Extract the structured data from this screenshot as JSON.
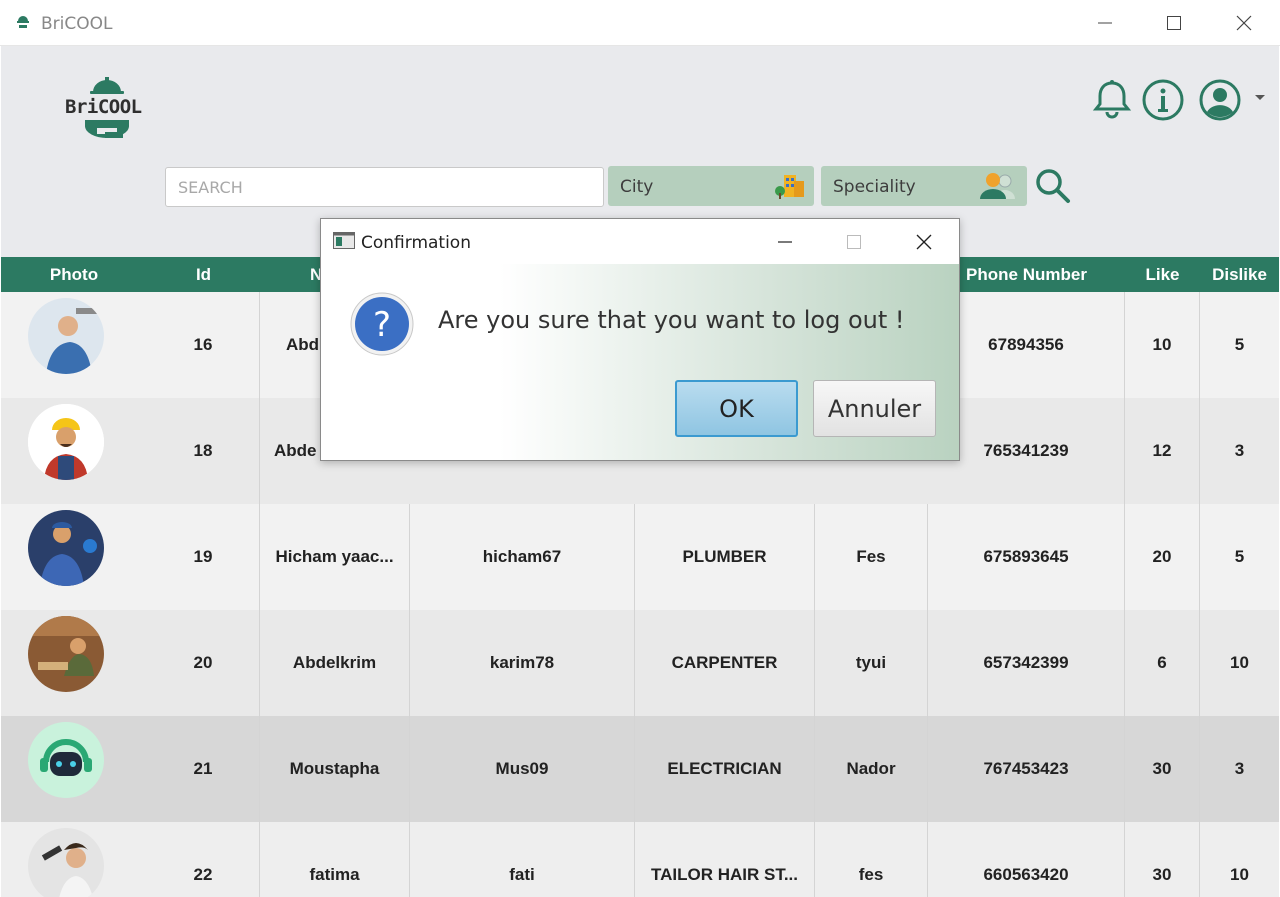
{
  "window": {
    "title": "BriCOOL"
  },
  "header": {
    "logo_text": "BriCOOL"
  },
  "search": {
    "placeholder": "SEARCH",
    "city_label": "City",
    "speciality_label": "Speciality"
  },
  "table": {
    "columns": [
      "Photo",
      "Id",
      "N",
      "",
      "",
      "",
      "Phone Number",
      "Like",
      "Dislike"
    ],
    "rows": [
      {
        "id": "16",
        "name": "Abd",
        "username": "",
        "speciality": "",
        "city": "",
        "phone": "67894356",
        "like": "10",
        "dislike": "5"
      },
      {
        "id": "18",
        "name": "Abde",
        "username": "",
        "speciality": "",
        "city": "",
        "phone": "765341239",
        "like": "12",
        "dislike": "3"
      },
      {
        "id": "19",
        "name": "Hicham yaac...",
        "username": "hicham67",
        "speciality": "PLUMBER",
        "city": "Fes",
        "phone": "675893645",
        "like": "20",
        "dislike": "5"
      },
      {
        "id": "20",
        "name": "Abdelkrim",
        "username": "karim78",
        "speciality": "CARPENTER",
        "city": "tyui",
        "phone": "657342399",
        "like": "6",
        "dislike": "10"
      },
      {
        "id": "21",
        "name": "Moustapha",
        "username": "Mus09",
        "speciality": "ELECTRICIAN",
        "city": "Nador",
        "phone": "767453423",
        "like": "30",
        "dislike": "3"
      },
      {
        "id": "22",
        "name": "fatima",
        "username": "fati",
        "speciality": "TAILOR HAIR ST...",
        "city": "fes",
        "phone": "660563420",
        "like": "30",
        "dislike": "10"
      }
    ]
  },
  "dialog": {
    "title": "Confirmation",
    "message": "Are you sure that you want to log out !",
    "ok_label": "OK",
    "cancel_label": "Annuler"
  },
  "colors": {
    "brand_green": "#2c7a62",
    "combo_green": "#b5cfbd",
    "dialog_blue": "#3b6fc4"
  }
}
